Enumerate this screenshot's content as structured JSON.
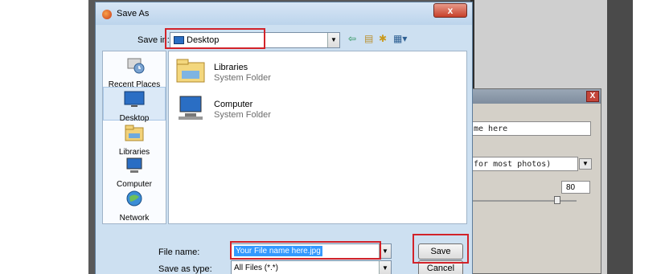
{
  "dialog": {
    "title": "Save As",
    "close_label": "x",
    "save_in_label": "Save in:",
    "save_in_value": "Desktop",
    "file_name_label": "File name:",
    "file_name_value": "Your File name here.jpg",
    "save_as_type_label": "Save as type:",
    "save_as_type_value": "All Files (*.*)",
    "save_button": "Save",
    "cancel_button": "Cancel"
  },
  "places": [
    {
      "label": "Recent Places",
      "icon": "recent-places-icon"
    },
    {
      "label": "Desktop",
      "icon": "desktop-icon"
    },
    {
      "label": "Libraries",
      "icon": "libraries-icon"
    },
    {
      "label": "Computer",
      "icon": "computer-icon"
    },
    {
      "label": "Network",
      "icon": "network-icon"
    }
  ],
  "files": [
    {
      "name": "Libraries",
      "type": "System Folder",
      "icon": "libraries-folder-icon"
    },
    {
      "name": "Computer",
      "type": "System Folder",
      "icon": "computer-icon"
    }
  ],
  "toolbar_icons": [
    "back-icon",
    "up-folder-icon",
    "new-folder-icon",
    "views-menu-icon"
  ],
  "behind_dialog": {
    "field1_text": "me here",
    "field2_text": "for most photos)",
    "quality_value": "80",
    "close_label": "X"
  },
  "colors": {
    "highlight": "#d2232a",
    "selection": "#3399ff"
  }
}
